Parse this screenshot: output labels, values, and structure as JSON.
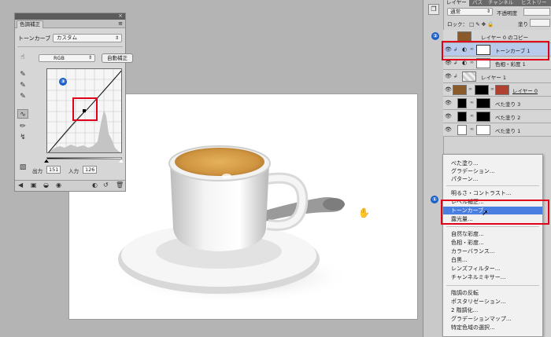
{
  "adjustments": {
    "tab": "色調補正",
    "curve_label": "トーンカーブ",
    "preset": "カスタム",
    "channel": "RGB",
    "auto_button": "自動補正",
    "output_label": "出力",
    "output_value": "151",
    "input_label": "入力",
    "input_value": "126"
  },
  "layers": {
    "tabs": [
      "レイヤー",
      "パス",
      "チャンネル",
      "ヒストリー"
    ],
    "blend_mode": "通常",
    "opacity_label": "不透明度",
    "lock_label": "ロック：",
    "fill_label": "塗り",
    "items": [
      {
        "name": "レイヤー 0 のコピー"
      },
      {
        "name": "トーンカーブ 1"
      },
      {
        "name": "色相・彩度 1"
      },
      {
        "name": "レイヤー 1"
      },
      {
        "name": "レイヤー 0"
      },
      {
        "name": "べた塗り 3"
      },
      {
        "name": "べた塗り 2"
      },
      {
        "name": "べた塗り 1"
      }
    ]
  },
  "menu": {
    "items": [
      "べた塗り...",
      "グラデーション...",
      "パターン...",
      "明るさ・コントラスト...",
      "レベル補正...",
      "トーンカーブ...",
      "露光量...",
      "自然な彩度...",
      "色相・彩度...",
      "カラーバランス...",
      "白黒...",
      "レンズフィルター...",
      "チャンネルミキサー...",
      "階調の反転",
      "ポスタリゼーション...",
      "2 階調化...",
      "グラデーションマップ...",
      "特定色域の選択..."
    ]
  },
  "badges": [
    "①",
    "②",
    "③"
  ],
  "colors": {
    "highlight": "#4a7ee0",
    "annotation": "#e0001a",
    "badge": "#1a5fc7",
    "selected_layer": "#b9cbea"
  }
}
